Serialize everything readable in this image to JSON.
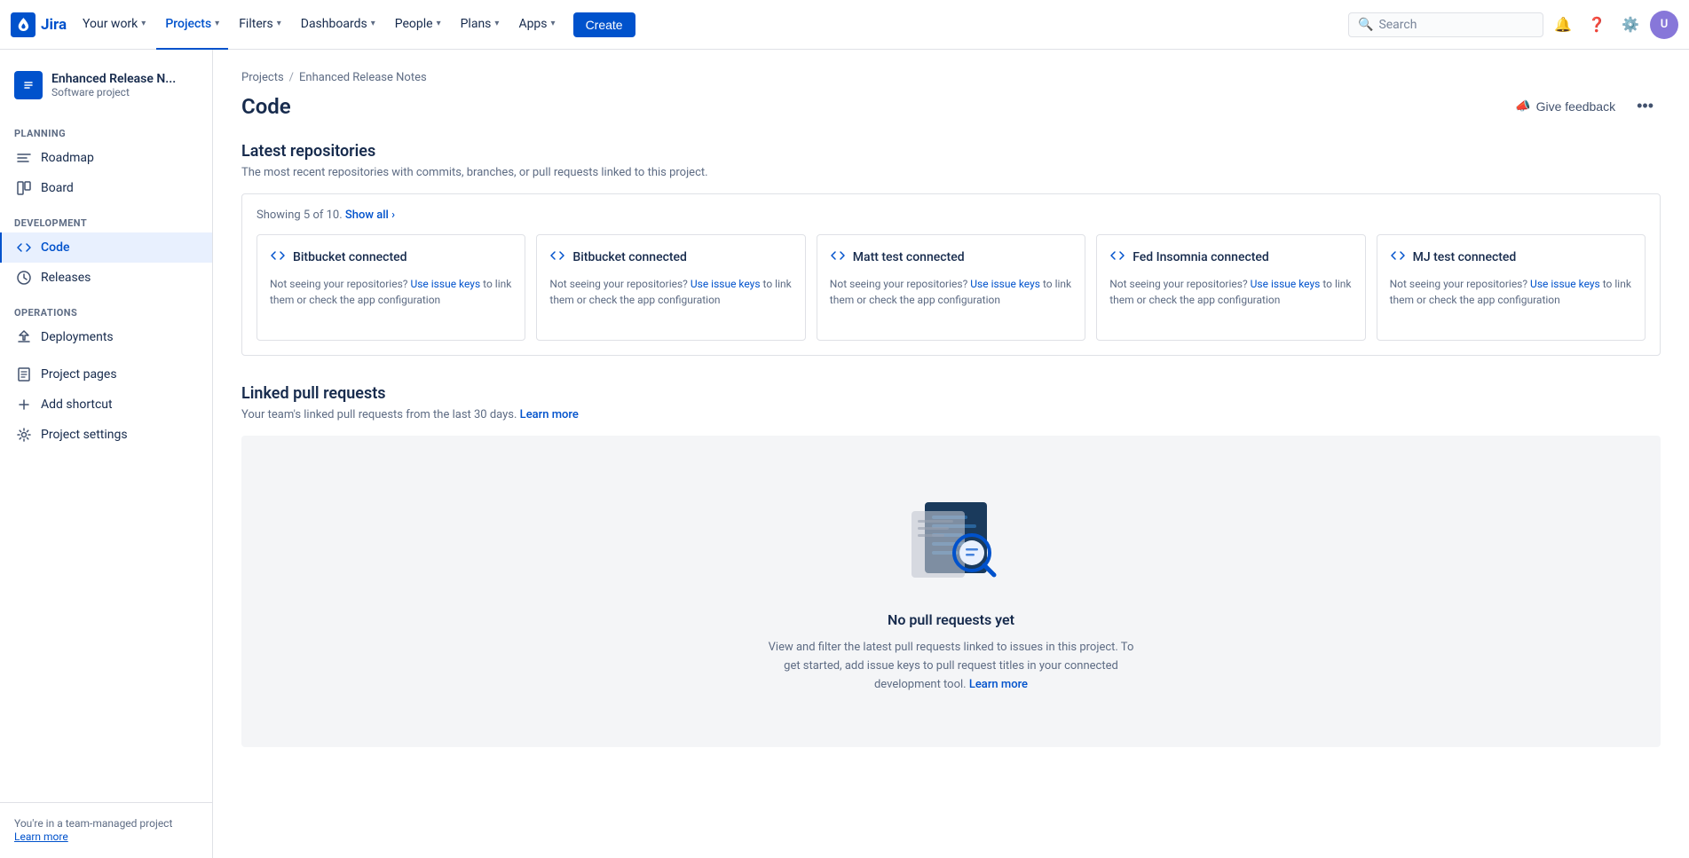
{
  "topnav": {
    "logo_text": "Jira",
    "nav_items": [
      {
        "id": "your-work",
        "label": "Your work",
        "has_dropdown": true,
        "active": false
      },
      {
        "id": "projects",
        "label": "Projects",
        "has_dropdown": true,
        "active": true
      },
      {
        "id": "filters",
        "label": "Filters",
        "has_dropdown": true,
        "active": false
      },
      {
        "id": "dashboards",
        "label": "Dashboards",
        "has_dropdown": true,
        "active": false
      },
      {
        "id": "people",
        "label": "People",
        "has_dropdown": true,
        "active": false
      },
      {
        "id": "plans",
        "label": "Plans",
        "has_dropdown": true,
        "active": false
      },
      {
        "id": "apps",
        "label": "Apps",
        "has_dropdown": true,
        "active": false
      }
    ],
    "create_label": "Create",
    "search_placeholder": "Search"
  },
  "sidebar": {
    "project_name": "Enhanced Release N...",
    "project_type": "Software project",
    "planning_title": "PLANNING",
    "development_title": "DEVELOPMENT",
    "operations_title": "OPERATIONS",
    "nav_items": [
      {
        "id": "roadmap",
        "label": "Roadmap",
        "section": "planning",
        "active": false,
        "icon": "roadmap"
      },
      {
        "id": "board",
        "label": "Board",
        "section": "planning",
        "active": false,
        "icon": "board"
      },
      {
        "id": "code",
        "label": "Code",
        "section": "development",
        "active": true,
        "icon": "code"
      },
      {
        "id": "releases",
        "label": "Releases",
        "section": "development",
        "active": false,
        "icon": "releases"
      },
      {
        "id": "deployments",
        "label": "Deployments",
        "section": "operations",
        "active": false,
        "icon": "deployments"
      },
      {
        "id": "project-pages",
        "label": "Project pages",
        "section": "other",
        "active": false,
        "icon": "pages"
      },
      {
        "id": "add-shortcut",
        "label": "Add shortcut",
        "section": "other",
        "active": false,
        "icon": "add"
      },
      {
        "id": "project-settings",
        "label": "Project settings",
        "section": "other",
        "active": false,
        "icon": "settings"
      }
    ],
    "footer_text": "You're in a team-managed project",
    "footer_link": "Learn more"
  },
  "breadcrumb": {
    "items": [
      {
        "label": "Projects",
        "link": true
      },
      {
        "label": "Enhanced Release Notes",
        "link": true
      }
    ]
  },
  "page": {
    "title": "Code",
    "feedback_label": "Give feedback",
    "more_label": "···"
  },
  "latest_repos": {
    "section_title": "Latest repositories",
    "section_subtitle": "The most recent repositories with commits, branches, or pull requests linked to this project.",
    "showing_text": "Showing 5 of 10.",
    "show_all_label": "Show all ›",
    "repos": [
      {
        "title": "Bitbucket connected",
        "body_prefix": "Not seeing your repositories?",
        "link_text": "Use issue keys",
        "body_suffix": "to link them or check the app configuration"
      },
      {
        "title": "Bitbucket connected",
        "body_prefix": "Not seeing your repositories?",
        "link_text": "Use issue keys",
        "body_suffix": "to link them or check the app configuration"
      },
      {
        "title": "Matt test connected",
        "body_prefix": "Not seeing your repositories?",
        "link_text": "Use issue keys",
        "body_suffix": "to link them or check the app configuration"
      },
      {
        "title": "Fed Insomnia connected",
        "body_prefix": "Not seeing your repositories?",
        "link_text": "Use issue keys",
        "body_suffix": "to link them or check the app configuration"
      },
      {
        "title": "MJ test connected",
        "body_prefix": "Not seeing your repositories?",
        "link_text": "Use issue keys",
        "body_suffix": "to link them or check the app configuration"
      }
    ]
  },
  "pull_requests": {
    "section_title": "Linked pull requests",
    "section_subtitle": "Your team's linked pull requests from the last 30 days.",
    "learn_more_label": "Learn more",
    "empty_title": "No pull requests yet",
    "empty_desc_prefix": "View and filter the latest pull requests linked to issues in this project. To get started, add issue keys to pull request titles in your connected development tool.",
    "empty_learn_more": "Learn more"
  },
  "colors": {
    "accent": "#0052cc",
    "text_primary": "#172b4d",
    "text_secondary": "#5e6c84",
    "border": "#dfe1e6",
    "bg_light": "#f4f5f7"
  }
}
